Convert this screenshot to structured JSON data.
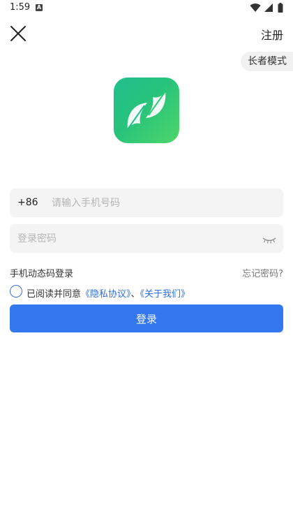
{
  "status_bar": {
    "time": "1:59",
    "notification_icon_letter": "A"
  },
  "header": {
    "close_icon": "close-icon",
    "register_label": "注册",
    "elder_mode_label": "长者模式"
  },
  "logo": {
    "icon": "app-leaf-logo",
    "gradient_start": "#1fbf8f",
    "gradient_end": "#4fd66a"
  },
  "form": {
    "country_code": "+86",
    "phone_placeholder": "请输入手机号码",
    "phone_value": "",
    "password_placeholder": "登录密码",
    "password_value": "",
    "password_visibility_icon": "eye-closed-icon"
  },
  "links": {
    "sms_login": "手机动态码登录",
    "forgot_password": "忘记密码?"
  },
  "agreement": {
    "checked": false,
    "prefix": "已阅读并同意",
    "privacy_link": "《隐私协议》",
    "separator": "、",
    "about_link": "《关于我们》"
  },
  "login_button": {
    "label": "登录",
    "color": "#3478f0"
  }
}
